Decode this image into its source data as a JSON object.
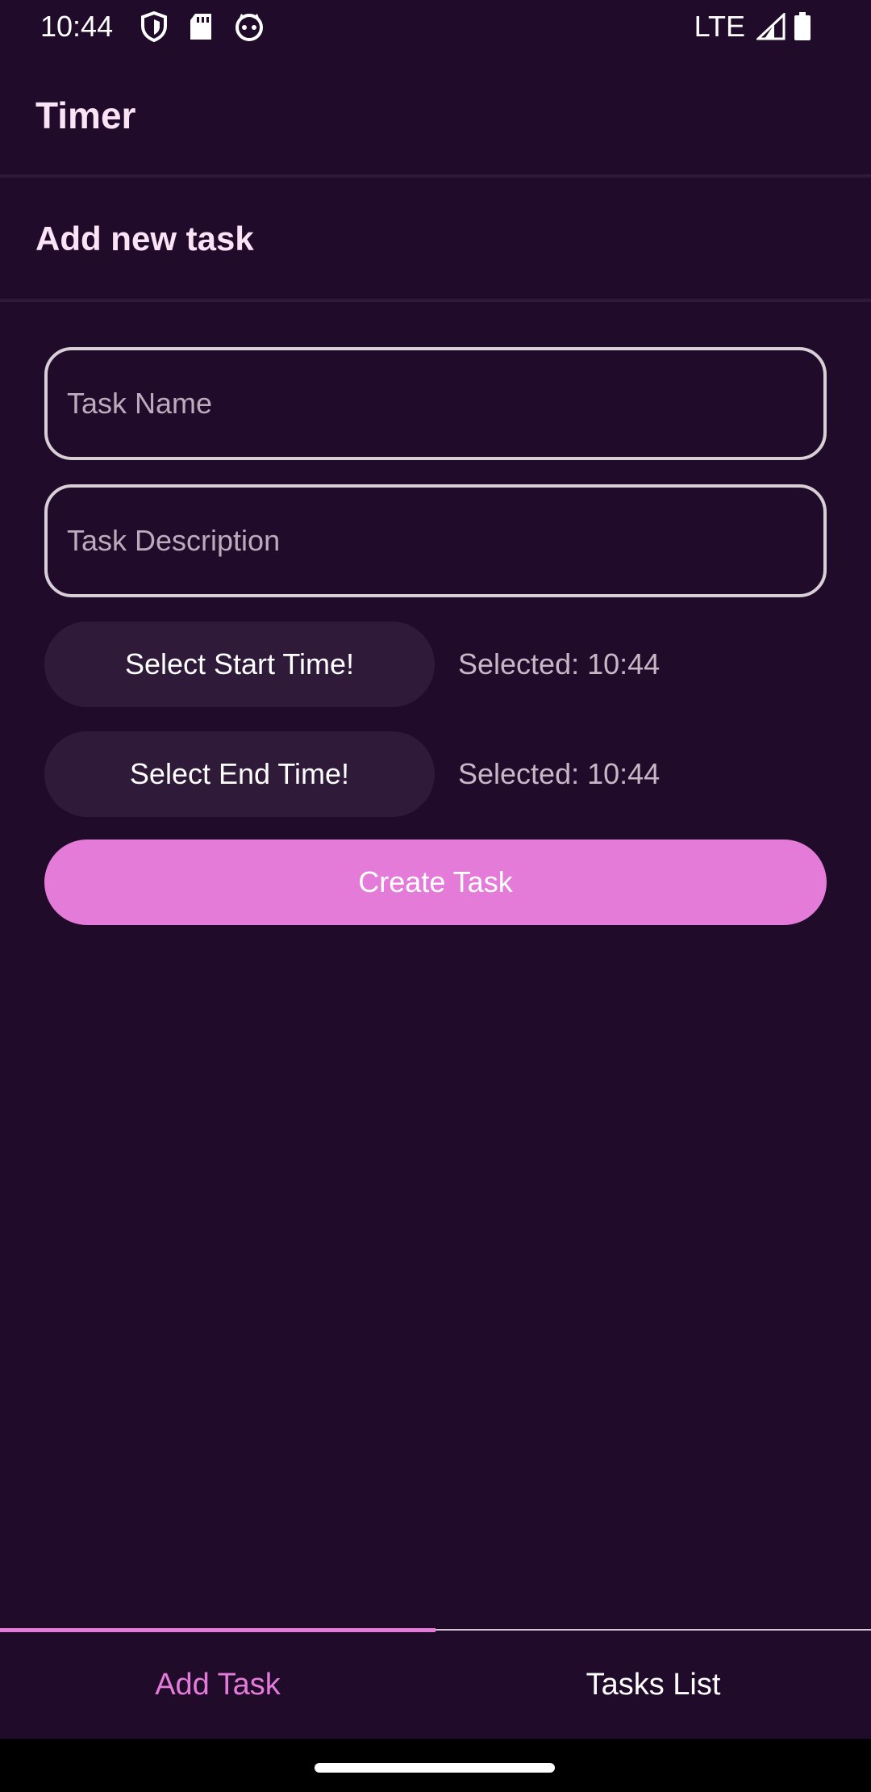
{
  "status_bar": {
    "time": "10:44",
    "network": "LTE",
    "left_icons": [
      "shield-icon",
      "sd-card-icon",
      "cat-face-icon"
    ],
    "right_icons": [
      "signal-icon",
      "battery-icon"
    ]
  },
  "app_bar": {
    "title": "Timer"
  },
  "section": {
    "title": "Add new task"
  },
  "form": {
    "task_name_placeholder": "Task Name",
    "task_description_placeholder": "Task Description",
    "start_button_label": "Select Start Time!",
    "start_selected": "Selected: 10:44",
    "end_button_label": "Select End Time!",
    "end_selected": "Selected: 10:44",
    "create_button_label": "Create Task"
  },
  "tabs": [
    {
      "label": "Add Task",
      "active": true
    },
    {
      "label": "Tasks List",
      "active": false
    }
  ],
  "colors": {
    "background": "#210b2b",
    "accent": "#e47bd8",
    "button_surface": "#2f1a3a"
  }
}
